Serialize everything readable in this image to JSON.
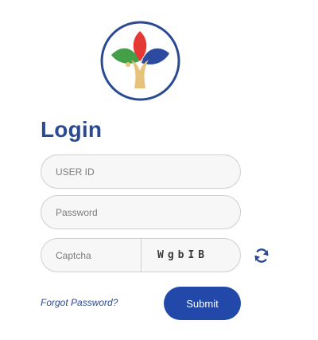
{
  "login": {
    "title": "Login",
    "userid_placeholder": "USER ID",
    "password_placeholder": "Password",
    "captcha_placeholder": "Captcha",
    "captcha_code": "WgbIB",
    "forgot_label": "Forgot Password?",
    "submit_label": "Submit"
  },
  "icons": {
    "logo": "tree-leaves-logo-icon",
    "refresh": "refresh-icon"
  },
  "colors": {
    "brand_blue": "#2a4a93",
    "button_blue": "#2249a9",
    "leaf_red": "#e53935",
    "leaf_green": "#43a047",
    "leaf_blue": "#2b4aa0",
    "trunk": "#e7c27a"
  }
}
